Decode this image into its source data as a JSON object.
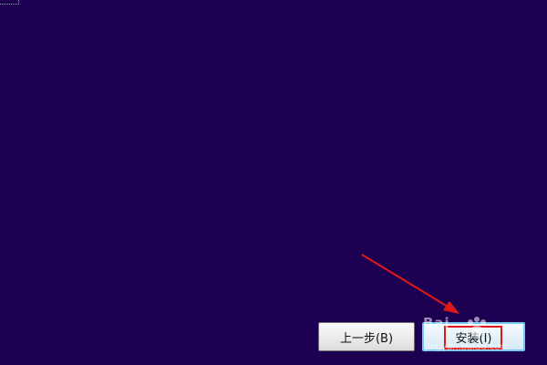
{
  "window": {
    "background": "#1d0052"
  },
  "buttons": {
    "back_label": "上一步(B)",
    "install_label": "安装(I)"
  },
  "annotations": {
    "arrow_color": "#e01818",
    "highlight_color": "#e01818",
    "highlight_target": "install-button"
  },
  "watermark": {
    "logo": "Bai",
    "url": "jingyan.baidu.com"
  }
}
